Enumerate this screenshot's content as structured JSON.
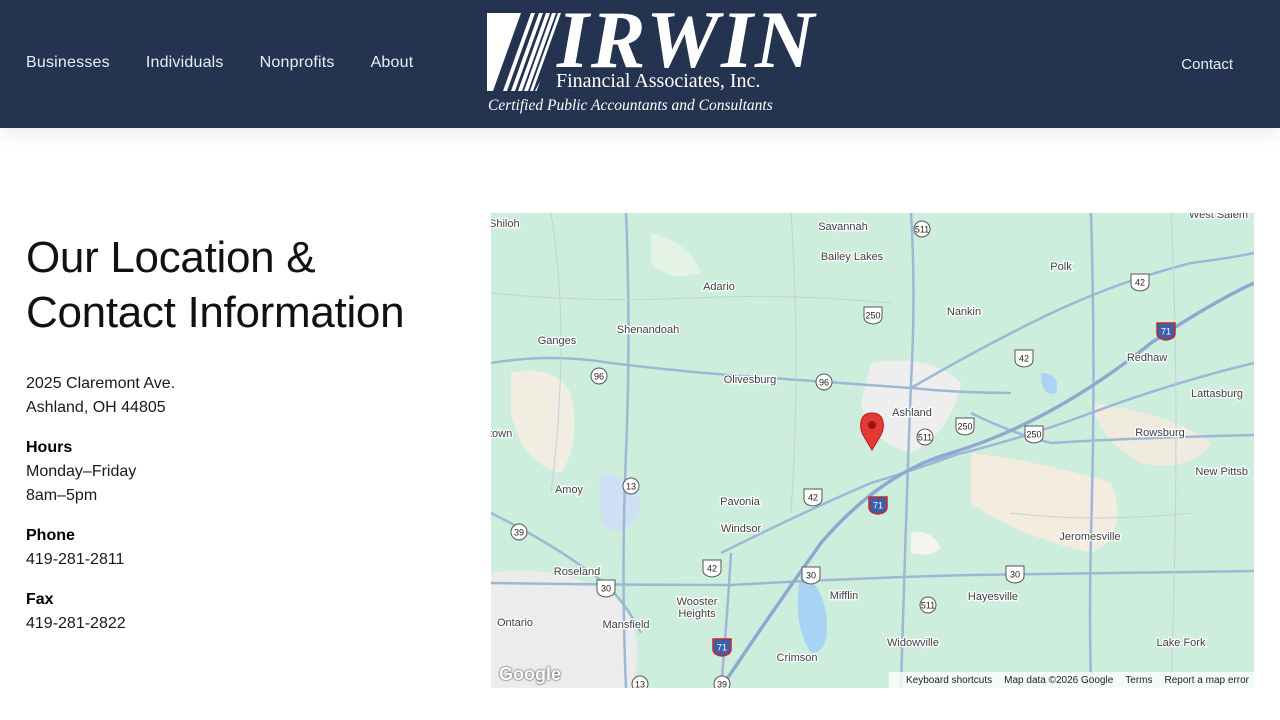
{
  "nav": {
    "left": [
      "Businesses",
      "Individuals",
      "Nonprofits",
      "About"
    ],
    "right": "Contact"
  },
  "logo": {
    "wordmark": "IRWIN",
    "subtitle": "Financial Associates, Inc.",
    "tagline": "Certified Public Accountants and Consultants"
  },
  "heading": {
    "line1": "Our Location &",
    "line2": "Contact Information"
  },
  "address": {
    "street": "2025 Claremont Ave.",
    "city": "Ashland, OH 44805"
  },
  "hours": {
    "label": "Hours",
    "days": "Monday–Friday",
    "time": "8am–5pm"
  },
  "phone": {
    "label": "Phone",
    "value": "419-281-2811"
  },
  "fax": {
    "label": "Fax",
    "value": "419-281-2822"
  },
  "map": {
    "google_logo": "Google",
    "footer": [
      "Keyboard shortcuts",
      "Map data ©2026 Google",
      "Terms",
      "Report a map error"
    ],
    "places": [
      "Shiloh",
      "Savannah",
      "West Salem",
      "Bailey Lakes",
      "Polk",
      "Adario",
      "Nankin",
      "Shenandoah",
      "Redhaw",
      "Ganges",
      "Olivesburg",
      "Lattasburg",
      "Ashland",
      "Rowsburg",
      "town",
      "New Pittsb",
      "Amoy",
      "Pavonia",
      "Windsor",
      "Jeromesville",
      "Roseland",
      "Wooster Heights",
      "Mifflin",
      "Hayesville",
      "Ontario",
      "Mansfield",
      "Widowville",
      "Lake Fork",
      "Crimson"
    ],
    "route_shields": [
      "511",
      "250",
      "42",
      "71",
      "96",
      "96",
      "42",
      "511",
      "250",
      "250",
      "13",
      "39",
      "42",
      "42",
      "71",
      "30",
      "30",
      "30",
      "511",
      "71",
      "13",
      "39"
    ]
  },
  "colors": {
    "header_bg": "#243350",
    "map_land": "#cdeedd",
    "marker": "#e53935"
  }
}
